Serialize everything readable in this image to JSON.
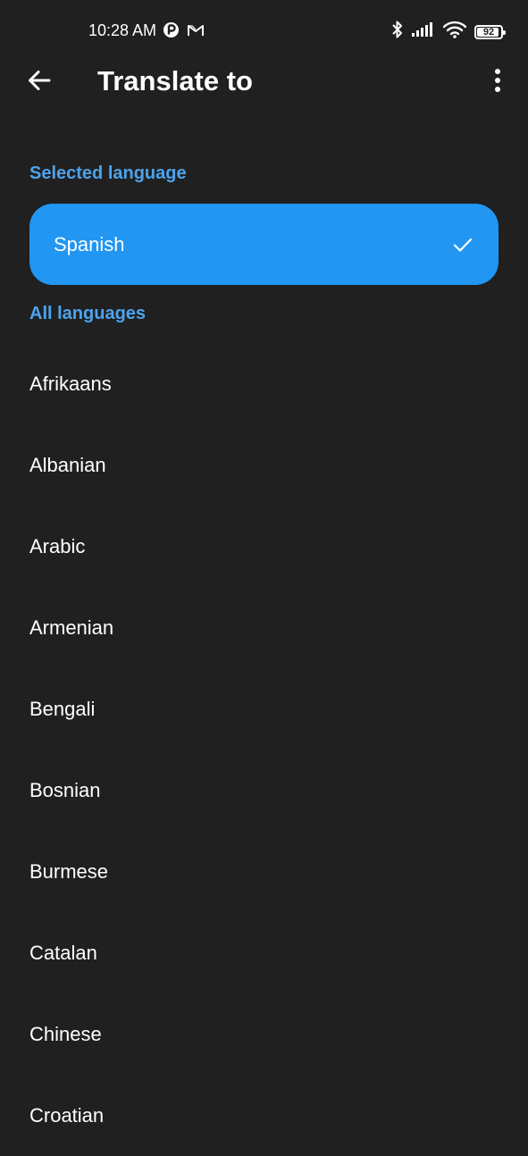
{
  "status_bar": {
    "time": "10:28 AM",
    "battery_level": "92",
    "battery_fraction": 0.92,
    "icons_left": [
      "notification-p-icon",
      "gmail-icon"
    ],
    "icons_right": [
      "bluetooth-icon",
      "signal-icon",
      "wifi-icon",
      "battery-icon"
    ]
  },
  "app_bar": {
    "title": "Translate to",
    "back_icon": "back-arrow-icon",
    "menu_icon": "more-vert-icon"
  },
  "selected_section": {
    "label": "Selected language",
    "language": "Spanish",
    "check_icon": "check-icon"
  },
  "all_section": {
    "label": "All languages",
    "languages": [
      "Afrikaans",
      "Albanian",
      "Arabic",
      "Armenian",
      "Bengali",
      "Bosnian",
      "Burmese",
      "Catalan",
      "Chinese",
      "Croatian"
    ]
  },
  "colors": {
    "background": "#202020",
    "accent": "#2196f3",
    "section_label": "#4da3ee",
    "text": "#ffffff"
  }
}
